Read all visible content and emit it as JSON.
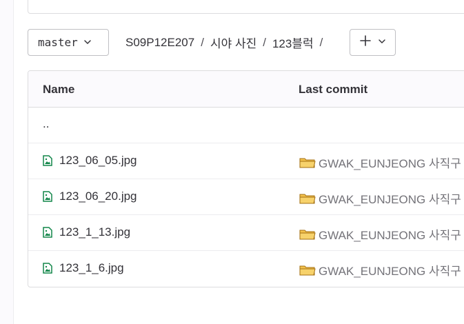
{
  "branch": {
    "name": "master",
    "icon": "chevron-down-icon"
  },
  "breadcrumb": {
    "items": [
      "S09P12E207",
      "시야 사진",
      "123블럭"
    ],
    "separator": "/"
  },
  "add_button": {
    "icon": "plus-icon",
    "caret": "chevron-down-icon"
  },
  "table": {
    "headers": {
      "name": "Name",
      "last_commit": "Last commit"
    },
    "parent_link": "..",
    "rows": [
      {
        "name": "123_06_05.jpg",
        "commit": "GWAK_EUNJEONG 사직구"
      },
      {
        "name": "123_06_20.jpg",
        "commit": "GWAK_EUNJEONG 사직구"
      },
      {
        "name": "123_1_13.jpg",
        "commit": "GWAK_EUNJEONG 사직구"
      },
      {
        "name": "123_1_6.jpg",
        "commit": "GWAK_EUNJEONG 사직구"
      }
    ]
  },
  "colors": {
    "file_icon": "#108548",
    "folder_icon": "#e2a52a",
    "border": "#dcdcde"
  }
}
